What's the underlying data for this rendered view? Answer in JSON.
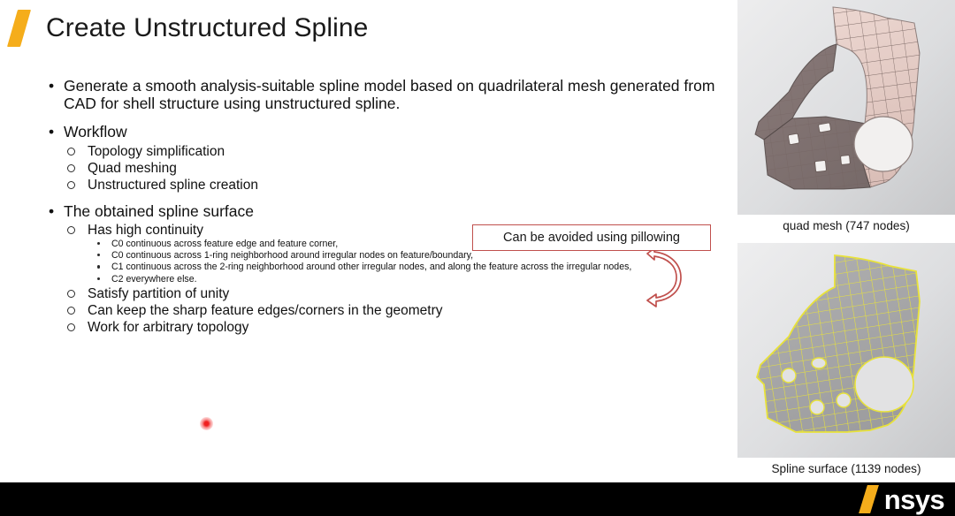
{
  "slide": {
    "title": "Create Unstructured Spline",
    "accent_color": "#f5ad1b",
    "callout_border_color": "#c0504d",
    "footer_color": "#000000"
  },
  "bullets": {
    "b1": "Generate a smooth analysis-suitable spline model based on quadrilateral mesh generated from CAD for shell structure using unstructured spline.",
    "b2": "Workflow",
    "b2_sub": [
      "Topology simplification",
      "Quad meshing",
      "Unstructured spline creation"
    ],
    "b3": "The obtained spline surface",
    "b3_sub": [
      "Has high continuity",
      "Satisfy partition of unity",
      "Can keep the sharp feature edges/corners in the geometry",
      "Work for arbitrary topology"
    ],
    "b3_sub_sub": [
      "C0 continuous across feature edge and feature corner,",
      "C0 continuous across 1-ring neighborhood around irregular nodes on feature/boundary,",
      "C1 continuous across the 2-ring neighborhood around other irregular nodes, and along the feature across the irregular nodes,",
      "C2 everywhere else."
    ]
  },
  "callout": {
    "text": "Can be avoided using pillowing"
  },
  "figures": [
    {
      "caption": "quad mesh (747 nodes)",
      "kind": "quad-mesh-bracket",
      "mesh_color": "#c9aba4",
      "node_count": 747
    },
    {
      "caption": "Spline surface (1139 nodes)",
      "kind": "spline-surface-bracket",
      "mesh_color": "#e8e23a",
      "node_count": 1139
    }
  ],
  "pointer": {
    "label": "laser-pointer-dot",
    "color": "#f02020"
  },
  "logo": {
    "word": "nsys",
    "slash_color": "#f5ad1b"
  }
}
